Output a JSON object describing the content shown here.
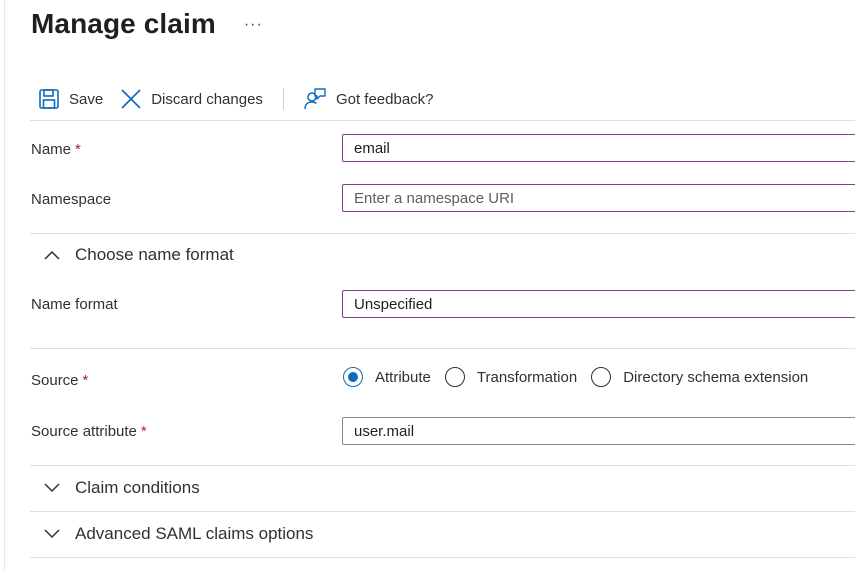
{
  "header": {
    "title": "Manage claim",
    "more_label": "···"
  },
  "toolbar": {
    "save_label": "Save",
    "discard_label": "Discard changes",
    "feedback_label": "Got feedback?"
  },
  "form": {
    "name": {
      "label": "Name",
      "required_mark": "*",
      "value": "email"
    },
    "namespace": {
      "label": "Namespace",
      "placeholder": "Enter a namespace URI"
    },
    "name_format_section": {
      "title": "Choose name format",
      "expanded": true
    },
    "name_format": {
      "label": "Name format",
      "value": "Unspecified"
    },
    "source": {
      "label": "Source",
      "required_mark": "*",
      "options": [
        {
          "label": "Attribute",
          "checked": true
        },
        {
          "label": "Transformation",
          "checked": false
        },
        {
          "label": "Directory schema extension",
          "checked": false
        }
      ]
    },
    "source_attribute": {
      "label": "Source attribute",
      "required_mark": "*",
      "value": "user.mail"
    },
    "claim_conditions_section": {
      "title": "Claim conditions",
      "expanded": false
    },
    "advanced_section": {
      "title": "Advanced SAML claims options",
      "expanded": false
    }
  },
  "colors": {
    "accent_border": "#7a3f8f",
    "primary_blue": "#0f6cbd",
    "required_red": "#a4262c",
    "divider": "#e1dfdd"
  },
  "icons": {
    "save": "save-icon",
    "discard": "close-icon",
    "feedback": "feedback-icon",
    "collapse": "chevron-up-icon",
    "expand": "chevron-down-icon"
  }
}
